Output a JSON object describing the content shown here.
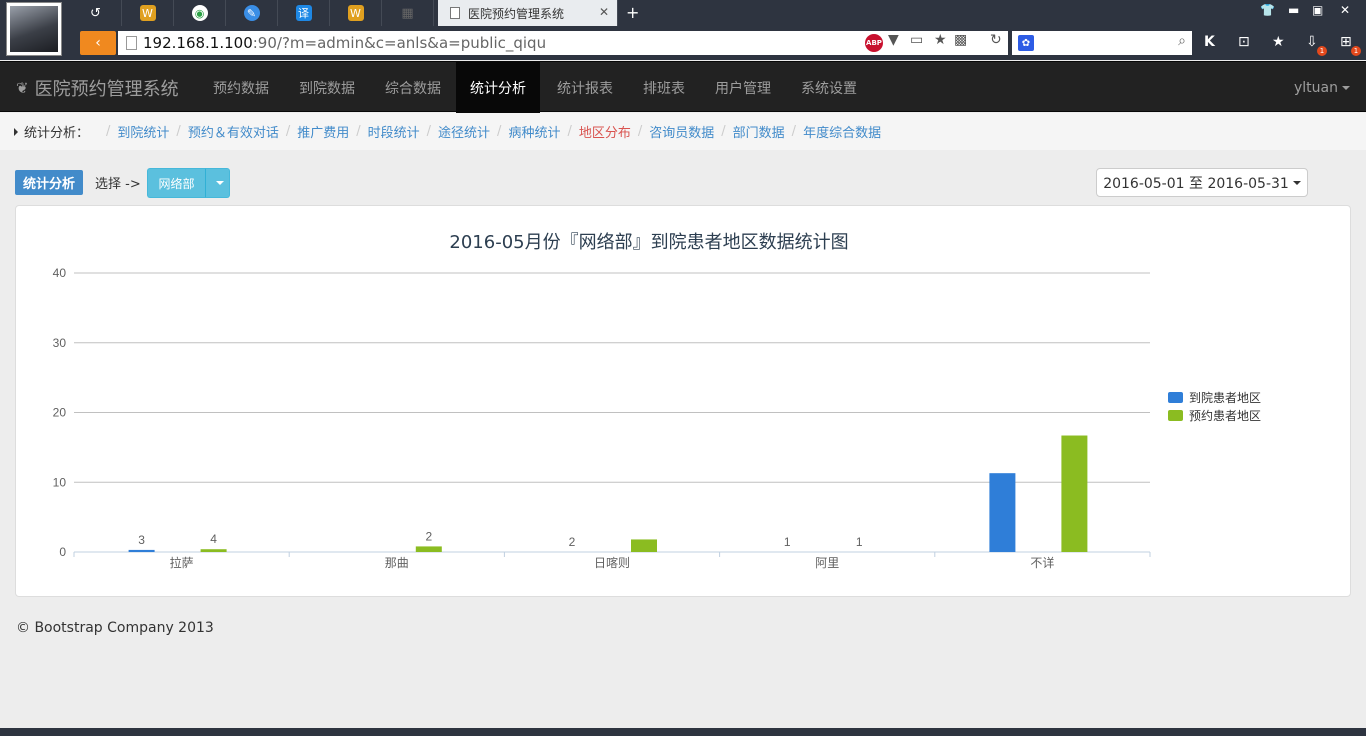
{
  "browser": {
    "active_tab_title": "医院预约管理系统",
    "url_host": "192.168.1.100",
    "url_path": ":90/?m=admin&c=anls&a=public_qiqu",
    "tab_glyphs": [
      "W",
      "◉",
      "✎",
      "译",
      "W"
    ],
    "badge_count": "1"
  },
  "nav": {
    "brand": "医院预约管理系统",
    "items": [
      "预约数据",
      "到院数据",
      "综合数据",
      "统计分析",
      "统计报表",
      "排班表",
      "用户管理",
      "系统设置"
    ],
    "active_index": 3,
    "user": "yltuan"
  },
  "breadcrumb": {
    "lead": "统计分析：",
    "items": [
      "到院统计",
      "预约＆有效对话",
      "推广费用",
      "时段统计",
      "途径统计",
      "病种统计",
      "地区分布",
      "咨询员数据",
      "部门数据",
      "年度综合数据"
    ],
    "current_index": 6
  },
  "toolbar": {
    "label": "统计分析",
    "choose_text": "选择 ->",
    "dept": "网络部",
    "date_range": "2016-05-01 至 2016-05-31"
  },
  "chart_data": {
    "type": "bar",
    "title": "2016-05月份『网络部』到院患者地区数据统计图",
    "categories": [
      "拉萨",
      "那曲",
      "日喀则",
      "阿里",
      "不详"
    ],
    "series": [
      {
        "name": "到院患者地区",
        "color": "#2f7ed8",
        "values": [
          0.3,
          0,
          0,
          0,
          11.3
        ],
        "labels": [
          "3",
          "",
          "2",
          "1",
          ""
        ]
      },
      {
        "name": "预约患者地区",
        "color": "#8bbc21",
        "values": [
          0.4,
          0.8,
          1.8,
          0,
          16.7
        ],
        "labels": [
          "4",
          "2",
          "",
          "1",
          ""
        ]
      }
    ],
    "ylim": [
      0,
      40
    ],
    "yticks": [
      0,
      10,
      20,
      30,
      40
    ],
    "grid": true,
    "legend_position": "right"
  },
  "footer": "© Bootstrap Company 2013"
}
